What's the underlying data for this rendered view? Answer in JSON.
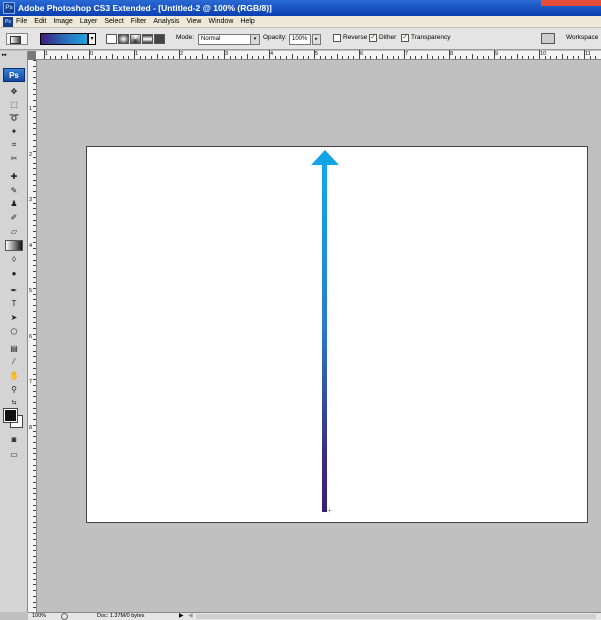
{
  "window": {
    "app_icon": "Ps",
    "title": "Adobe Photoshop CS3 Extended - [Untitled-2 @ 100% (RGB/8)]"
  },
  "menu": [
    "File",
    "Edit",
    "Image",
    "Layer",
    "Select",
    "Filter",
    "Analysis",
    "View",
    "Window",
    "Help"
  ],
  "options": {
    "mode_label": "Mode:",
    "mode_value": "Normal",
    "opacity_label": "Opacity:",
    "opacity_value": "100%",
    "reverse_label": "Reverse",
    "reverse_checked": false,
    "dither_label": "Dither",
    "dither_checked": true,
    "transparency_label": "Transparency",
    "transparency_checked": true,
    "workspace_label": "Workspace",
    "gradient_colors": [
      "#3d1c7d",
      "#2a6ab8",
      "#1fa4e0"
    ],
    "dropdown_arrow": "▾",
    "opacity_arrow": "▸",
    "check_mark": "✓"
  },
  "toolbox": {
    "logo": "Ps",
    "grip": "▸▸",
    "foreground_color": "#111111",
    "background_color": "#ffffff"
  },
  "rulers": {
    "horizontal": [
      "1",
      "0",
      "1",
      "2",
      "3",
      "4",
      "5",
      "6",
      "7",
      "8",
      "9",
      "10",
      "11"
    ],
    "vertical": [
      "1",
      "2",
      "3",
      "4",
      "5",
      "6",
      "7",
      "8"
    ]
  },
  "canvas": {
    "gradient_top_color": "#11a9e8",
    "gradient_bottom_color": "#3a1f70",
    "cursor": "+"
  },
  "status": {
    "zoom": "100%",
    "doc_info": "Doc: 1.37M/0 bytes",
    "arrow": "▶",
    "left_arrow": "◀"
  }
}
